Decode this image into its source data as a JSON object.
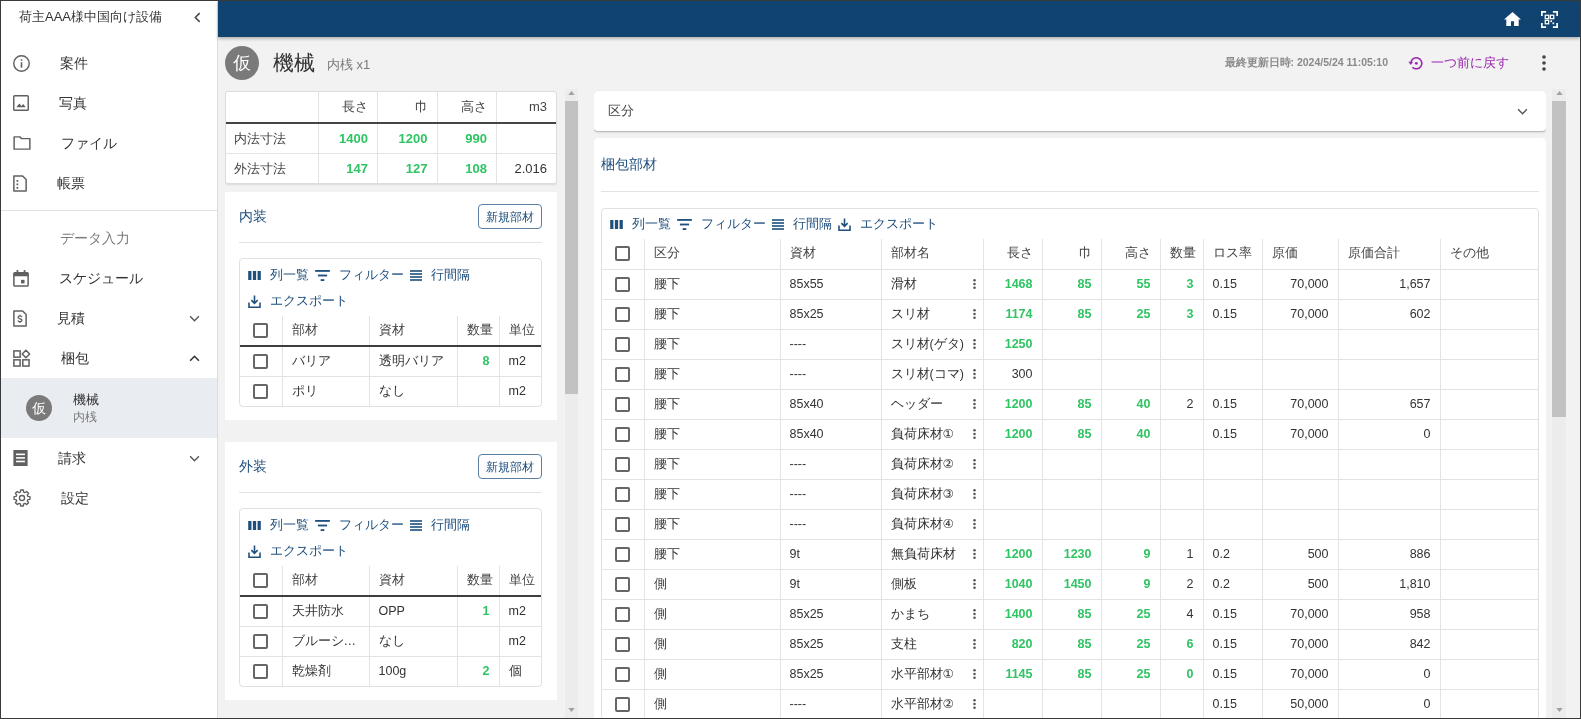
{
  "sidebar": {
    "title": "荷主AAA様中国向け設備",
    "items": [
      {
        "kind": "link",
        "label": "案件"
      },
      {
        "kind": "link",
        "label": "写真"
      },
      {
        "kind": "link",
        "label": "ファイル"
      },
      {
        "kind": "link",
        "label": "帳票"
      }
    ],
    "section": {
      "label": "データ入力",
      "items": [
        {
          "kind": "link",
          "label": "スケジュール"
        },
        {
          "kind": "group",
          "label": "見積",
          "expanded": false
        },
        {
          "kind": "group",
          "label": "梱包",
          "expanded": true,
          "children": [
            {
              "badge": "仮",
              "title": "機械",
              "subtitle": "内桟",
              "selected": true
            }
          ]
        },
        {
          "kind": "group",
          "label": "請求",
          "expanded": false
        },
        {
          "kind": "link",
          "label": "設定"
        }
      ]
    }
  },
  "header": {
    "badge": "仮",
    "title": "機械",
    "subtitle": "内桟 x1",
    "last_updated": "最終更新日時: 2024/5/24 11:05:10",
    "undo_button": "一つ前に戻す"
  },
  "dimensions": {
    "columns": [
      "長さ",
      "巾",
      "高さ",
      "m3"
    ],
    "rows": [
      {
        "label": "内法寸法",
        "cells": [
          {
            "text": "1400",
            "entered": true
          },
          {
            "text": "1200",
            "entered": true
          },
          {
            "text": "990",
            "entered": true
          },
          null
        ]
      },
      {
        "label": "外法寸法",
        "cells": [
          {
            "text": "147",
            "entered": true
          },
          {
            "text": "127",
            "entered": true
          },
          {
            "text": "108",
            "entered": true
          },
          {
            "text": "2.016",
            "entered": false
          }
        ]
      }
    ]
  },
  "sections": [
    {
      "title": "内装",
      "add_button": "新規部材",
      "toolbar": [
        "列一覧",
        "フィルター",
        "行間隔",
        "エクスポート"
      ],
      "all_checked": false,
      "columns": [
        "部材",
        "資材",
        "数量",
        "単位"
      ],
      "rows": [
        {
          "checked": false,
          "cells": [
            {
              "text": "バリア",
              "entered": false
            },
            {
              "text": "透明バリア",
              "entered": false
            },
            {
              "text": "8",
              "entered": true
            },
            {
              "text": "m2",
              "entered": false
            }
          ]
        },
        {
          "checked": false,
          "cells": [
            {
              "text": "ポリ",
              "entered": false
            },
            {
              "text": "なし",
              "entered": false
            },
            null,
            {
              "text": "m2",
              "entered": false
            }
          ]
        }
      ]
    },
    {
      "title": "外装",
      "add_button": "新規部材",
      "toolbar": [
        "列一覧",
        "フィルター",
        "行間隔",
        "エクスポート"
      ],
      "all_checked": false,
      "columns": [
        "部材",
        "資材",
        "数量",
        "単位"
      ],
      "rows": [
        {
          "checked": false,
          "cells": [
            {
              "text": "天井防水",
              "entered": false
            },
            {
              "text": "OPP",
              "entered": false
            },
            {
              "text": "1",
              "entered": true
            },
            {
              "text": "m2",
              "entered": false
            }
          ]
        },
        {
          "checked": false,
          "cells": [
            {
              "text": "ブルーシ…",
              "entered": false
            },
            {
              "text": "なし",
              "entered": false
            },
            null,
            {
              "text": "m2",
              "entered": false
            }
          ]
        },
        {
          "checked": false,
          "cells": [
            {
              "text": "乾燥剤",
              "entered": false
            },
            {
              "text": "100g",
              "entered": false
            },
            {
              "text": "2",
              "entered": true
            },
            {
              "text": "個",
              "entered": false
            }
          ]
        }
      ]
    }
  ],
  "accordion": {
    "label": "区分",
    "expanded": false
  },
  "materials": {
    "title": "梱包部材",
    "toolbar": [
      "列一覧",
      "フィルター",
      "行間隔",
      "エクスポート"
    ],
    "all_checked": false,
    "columns": [
      "区分",
      "資材",
      "部材名",
      "長さ",
      "巾",
      "高さ",
      "数量",
      "ロス率",
      "原価",
      "原価合計",
      "その他"
    ],
    "rows": [
      {
        "checked": false,
        "cells": [
          {
            "text": "腰下",
            "entered": false
          },
          {
            "text": "85x55",
            "entered": false
          },
          {
            "text": "滑材",
            "entered": false
          },
          {
            "text": "1468",
            "entered": true
          },
          {
            "text": "85",
            "entered": true
          },
          {
            "text": "55",
            "entered": true
          },
          {
            "text": "3",
            "entered": true
          },
          {
            "text": "0.15",
            "entered": false
          },
          {
            "text": "70,000",
            "entered": false
          },
          {
            "text": "1,657",
            "entered": false
          },
          null
        ]
      },
      {
        "checked": false,
        "cells": [
          {
            "text": "腰下",
            "entered": false
          },
          {
            "text": "85x25",
            "entered": false
          },
          {
            "text": "スリ材",
            "entered": false
          },
          {
            "text": "1174",
            "entered": true
          },
          {
            "text": "85",
            "entered": true
          },
          {
            "text": "25",
            "entered": true
          },
          {
            "text": "3",
            "entered": true
          },
          {
            "text": "0.15",
            "entered": false
          },
          {
            "text": "70,000",
            "entered": false
          },
          {
            "text": "602",
            "entered": false
          },
          null
        ]
      },
      {
        "checked": false,
        "cells": [
          {
            "text": "腰下",
            "entered": false
          },
          {
            "text": "----",
            "entered": false
          },
          {
            "text": "スリ材(ゲタ)",
            "entered": false
          },
          {
            "text": "1250",
            "entered": true
          },
          null,
          null,
          null,
          null,
          null,
          null,
          null
        ]
      },
      {
        "checked": false,
        "cells": [
          {
            "text": "腰下",
            "entered": false
          },
          {
            "text": "----",
            "entered": false
          },
          {
            "text": "スリ材(コマ)",
            "entered": false
          },
          {
            "text": "300",
            "entered": false
          },
          null,
          null,
          null,
          null,
          null,
          null,
          null
        ]
      },
      {
        "checked": false,
        "cells": [
          {
            "text": "腰下",
            "entered": false
          },
          {
            "text": "85x40",
            "entered": false
          },
          {
            "text": "ヘッダー",
            "entered": false
          },
          {
            "text": "1200",
            "entered": true
          },
          {
            "text": "85",
            "entered": true
          },
          {
            "text": "40",
            "entered": true
          },
          {
            "text": "2",
            "entered": false
          },
          {
            "text": "0.15",
            "entered": false
          },
          {
            "text": "70,000",
            "entered": false
          },
          {
            "text": "657",
            "entered": false
          },
          null
        ]
      },
      {
        "checked": false,
        "cells": [
          {
            "text": "腰下",
            "entered": false
          },
          {
            "text": "85x40",
            "entered": false
          },
          {
            "text": "負荷床材①",
            "entered": false
          },
          {
            "text": "1200",
            "entered": true
          },
          {
            "text": "85",
            "entered": true
          },
          {
            "text": "40",
            "entered": true
          },
          null,
          {
            "text": "0.15",
            "entered": false
          },
          {
            "text": "70,000",
            "entered": false
          },
          {
            "text": "0",
            "entered": false
          },
          null
        ]
      },
      {
        "checked": false,
        "cells": [
          {
            "text": "腰下",
            "entered": false
          },
          {
            "text": "----",
            "entered": false
          },
          {
            "text": "負荷床材②",
            "entered": false
          },
          null,
          null,
          null,
          null,
          null,
          null,
          null,
          null
        ]
      },
      {
        "checked": false,
        "cells": [
          {
            "text": "腰下",
            "entered": false
          },
          {
            "text": "----",
            "entered": false
          },
          {
            "text": "負荷床材③",
            "entered": false
          },
          null,
          null,
          null,
          null,
          null,
          null,
          null,
          null
        ]
      },
      {
        "checked": false,
        "cells": [
          {
            "text": "腰下",
            "entered": false
          },
          {
            "text": "----",
            "entered": false
          },
          {
            "text": "負荷床材④",
            "entered": false
          },
          null,
          null,
          null,
          null,
          null,
          null,
          null,
          null
        ]
      },
      {
        "checked": false,
        "cells": [
          {
            "text": "腰下",
            "entered": false
          },
          {
            "text": "9t",
            "entered": false
          },
          {
            "text": "無負荷床材",
            "entered": false
          },
          {
            "text": "1200",
            "entered": true
          },
          {
            "text": "1230",
            "entered": true
          },
          {
            "text": "9",
            "entered": true
          },
          {
            "text": "1",
            "entered": false
          },
          {
            "text": "0.2",
            "entered": false
          },
          {
            "text": "500",
            "entered": false
          },
          {
            "text": "886",
            "entered": false
          },
          null
        ]
      },
      {
        "checked": false,
        "cells": [
          {
            "text": "側",
            "entered": false
          },
          {
            "text": "9t",
            "entered": false
          },
          {
            "text": "側板",
            "entered": false
          },
          {
            "text": "1040",
            "entered": true
          },
          {
            "text": "1450",
            "entered": true
          },
          {
            "text": "9",
            "entered": true
          },
          {
            "text": "2",
            "entered": false
          },
          {
            "text": "0.2",
            "entered": false
          },
          {
            "text": "500",
            "entered": false
          },
          {
            "text": "1,810",
            "entered": false
          },
          null
        ]
      },
      {
        "checked": false,
        "cells": [
          {
            "text": "側",
            "entered": false
          },
          {
            "text": "85x25",
            "entered": false
          },
          {
            "text": "かまち",
            "entered": false
          },
          {
            "text": "1400",
            "entered": true
          },
          {
            "text": "85",
            "entered": true
          },
          {
            "text": "25",
            "entered": true
          },
          {
            "text": "4",
            "entered": false
          },
          {
            "text": "0.15",
            "entered": false
          },
          {
            "text": "70,000",
            "entered": false
          },
          {
            "text": "958",
            "entered": false
          },
          null
        ]
      },
      {
        "checked": false,
        "cells": [
          {
            "text": "側",
            "entered": false
          },
          {
            "text": "85x25",
            "entered": false
          },
          {
            "text": "支柱",
            "entered": false
          },
          {
            "text": "820",
            "entered": true
          },
          {
            "text": "85",
            "entered": true
          },
          {
            "text": "25",
            "entered": true
          },
          {
            "text": "6",
            "entered": true
          },
          {
            "text": "0.15",
            "entered": false
          },
          {
            "text": "70,000",
            "entered": false
          },
          {
            "text": "842",
            "entered": false
          },
          null
        ]
      },
      {
        "checked": false,
        "cells": [
          {
            "text": "側",
            "entered": false
          },
          {
            "text": "85x25",
            "entered": false
          },
          {
            "text": "水平部材①",
            "entered": false
          },
          {
            "text": "1145",
            "entered": true
          },
          {
            "text": "85",
            "entered": true
          },
          {
            "text": "25",
            "entered": true
          },
          {
            "text": "0",
            "entered": true
          },
          {
            "text": "0.15",
            "entered": false
          },
          {
            "text": "70,000",
            "entered": false
          },
          {
            "text": "0",
            "entered": false
          },
          null
        ]
      },
      {
        "checked": false,
        "cells": [
          {
            "text": "側",
            "entered": false
          },
          {
            "text": "----",
            "entered": false
          },
          {
            "text": "水平部材②",
            "entered": false
          },
          null,
          null,
          null,
          null,
          {
            "text": "0.15",
            "entered": false
          },
          {
            "text": "50,000",
            "entered": false
          },
          {
            "text": "0",
            "entered": false
          },
          null
        ]
      }
    ]
  }
}
